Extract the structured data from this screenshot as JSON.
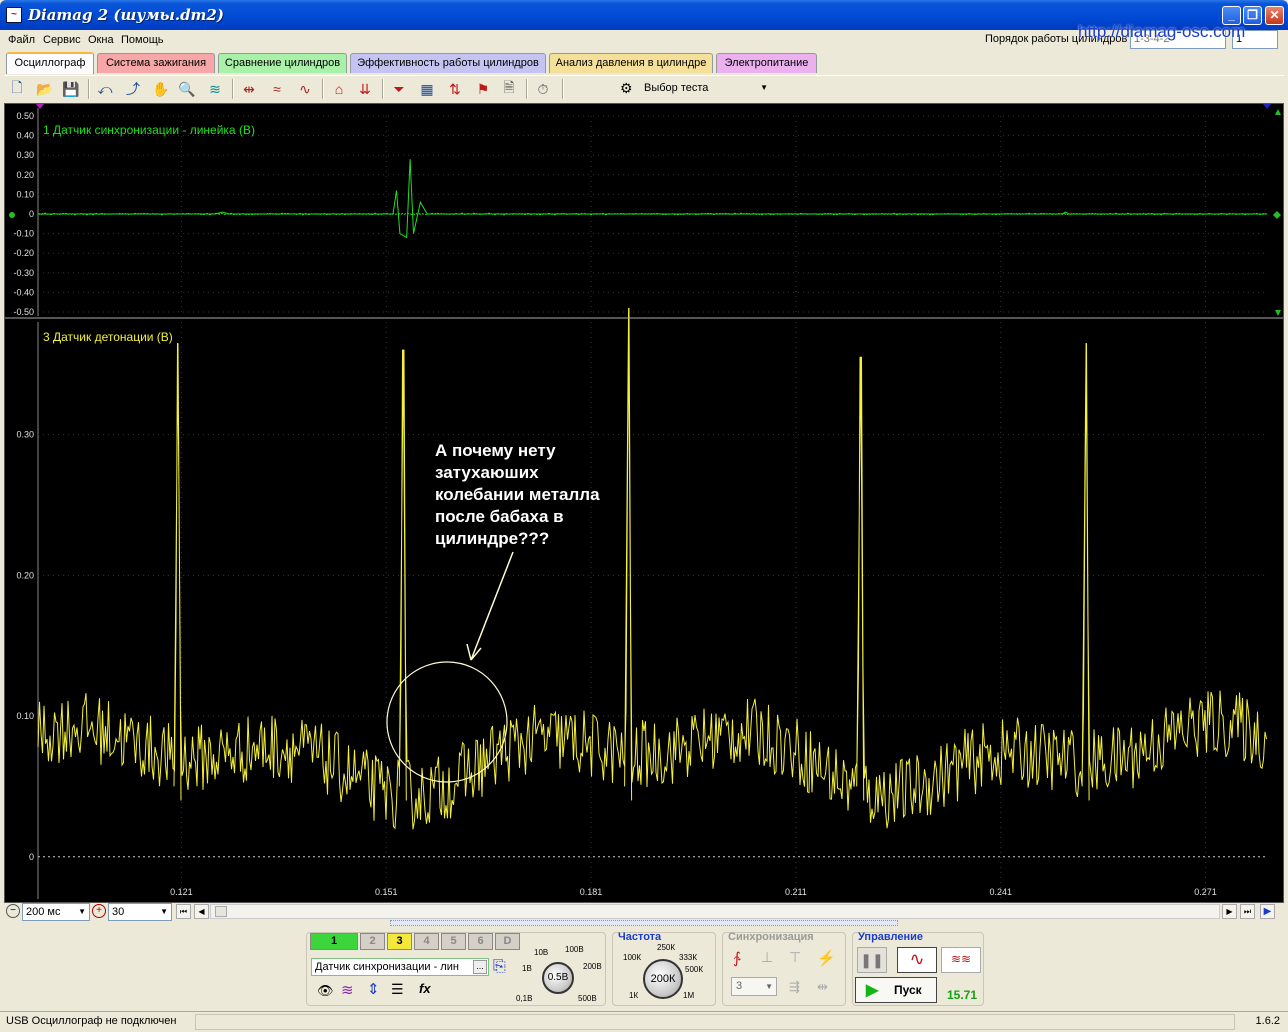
{
  "window": {
    "title": "Diamag 2 (шумы.dm2)",
    "app_icon_glyph": "~",
    "buttons": {
      "minimize": "_",
      "maximize": "❐",
      "close": "✕"
    }
  },
  "menu": {
    "items": [
      "Файл",
      "Сервис",
      "Окна",
      "Помощь"
    ]
  },
  "header": {
    "order_label": "Порядок работы цилиндров",
    "order_value": "1-3-4-2",
    "order_value2": "1",
    "site_url": "http://diamag-osc.com"
  },
  "tabs": [
    {
      "label": "Осциллограф",
      "color": "#fcfcfe"
    },
    {
      "label": "Система зажигания",
      "color": "#f7a7a7"
    },
    {
      "label": "Сравнение цилиндров",
      "color": "#a9f0a9"
    },
    {
      "label": "Эффективность работы цилиндров",
      "color": "#c4c4f3"
    },
    {
      "label": "Анализ давления в цилиндре",
      "color": "#f5e09a"
    },
    {
      "label": "Электропитание",
      "color": "#ebb1ef"
    }
  ],
  "toolbar": {
    "icons": [
      "new-file-icon",
      "open-file-icon",
      "save-icon",
      "sync-icon",
      "measure-icon",
      "hand-icon",
      "zoom-icon",
      "filter-icon",
      "expand-icon",
      "wave-compare-icon",
      "wave-add-icon",
      "auto-scale-icon",
      "zero-offset-icon",
      "filter-funnel-icon",
      "table-icon",
      "cursor-line-icon",
      "flag-icon",
      "notes-icon",
      "auto-timer-icon"
    ],
    "test_select_label": "Выбор теста"
  },
  "scope": {
    "channel1": {
      "label": "1 Датчик синхронизации - линейка (В)",
      "color": "#1ee11e",
      "y_ticks": [
        "0.50",
        "0.40",
        "0.30",
        "0.20",
        "0.10",
        "0",
        "-0.10",
        "-0.20",
        "-0.30",
        "-0.40",
        "-0.50"
      ]
    },
    "channel3": {
      "label": "3 Датчик детонации (В)",
      "color": "#f4f03c",
      "y_ticks": [
        "0.30",
        "0.20",
        "0.10",
        "0"
      ]
    },
    "x_ticks": [
      "0.121",
      "0.151",
      "0.181",
      "0.211",
      "0.241",
      "0.271"
    ],
    "marker_left": "1",
    "marker_right": "2",
    "annotation": "А почему нету\nзатухаюших\nколебании металла\nпосле бабаха в\nцилиндре???"
  },
  "chart_data": [
    {
      "type": "line",
      "title": "1 Датчик синхронизации - линейка (В)",
      "xlabel": "",
      "ylabel": "В",
      "ylim": [
        -0.5,
        0.5
      ],
      "x_ticks": [
        0.121,
        0.151,
        0.181,
        0.211,
        0.241,
        0.271
      ],
      "xlim": [
        0.1,
        0.28
      ],
      "series": [
        {
          "name": "1 Датчик синхронизации - линейка",
          "x": [
            0.1,
            0.126,
            0.127,
            0.128,
            0.152,
            0.1525,
            0.153,
            0.154,
            0.1545,
            0.155,
            0.156,
            0.157,
            0.2,
            0.25,
            0.2505,
            0.251,
            0.28
          ],
          "y": [
            0,
            0,
            0.01,
            0,
            0,
            0.12,
            -0.1,
            -0.12,
            0.28,
            -0.1,
            0.06,
            0,
            0,
            0,
            0.01,
            0,
            0
          ]
        }
      ]
    },
    {
      "type": "line",
      "title": "3 Датчик детонации (В)",
      "xlabel": "",
      "ylabel": "В",
      "ylim": [
        -0.03,
        0.38
      ],
      "x_ticks": [
        0.121,
        0.151,
        0.181,
        0.211,
        0.241,
        0.271
      ],
      "xlim": [
        0.1,
        0.28
      ],
      "series": [
        {
          "name": "3 Датчик детонации",
          "spikes": [
            {
              "x": 0.1205,
              "y": 0.365
            },
            {
              "x": 0.1535,
              "y": 0.36
            },
            {
              "x": 0.1865,
              "y": 0.39
            },
            {
              "x": 0.2205,
              "y": 0.355
            },
            {
              "x": 0.2535,
              "y": 0.365
            }
          ],
          "baseline_envelope": [
            0.025,
            0.115
          ]
        }
      ]
    }
  ],
  "bottom": {
    "timebase": "200 мс",
    "count": "30",
    "channel_buttons": [
      {
        "label": "1",
        "bg": "#3cd63c",
        "fg": "#000"
      },
      {
        "label": "2",
        "bg": "#d4d0c8",
        "fg": "#888"
      },
      {
        "label": "3",
        "bg": "#f4e83c",
        "fg": "#000"
      },
      {
        "label": "4",
        "bg": "#d4d0c8",
        "fg": "#888"
      },
      {
        "label": "5",
        "bg": "#d4d0c8",
        "fg": "#888"
      },
      {
        "label": "6",
        "bg": "#d4d0c8",
        "fg": "#888"
      },
      {
        "label": "D",
        "bg": "#d4d0c8",
        "fg": "#888"
      }
    ],
    "sensor_value": "Датчик синхронизации - лин",
    "sensor_more": "...",
    "volt_knob": {
      "value": "0.5В",
      "labels": [
        "10В",
        "100В",
        "200В",
        "500В",
        "0,1В",
        "1В"
      ]
    },
    "freq_title": "Частота",
    "freq_knob": {
      "value": "200К",
      "labels": [
        "250К",
        "333К",
        "500К",
        "1М",
        "1К",
        "100К"
      ]
    },
    "sync_title": "Синхронизация",
    "sync_value": "3",
    "control_title": "Управление",
    "start_label": "Пуск",
    "fps": "15.71"
  },
  "status": {
    "text": "USB Осциллограф не подключен",
    "version": "1.6.2"
  }
}
